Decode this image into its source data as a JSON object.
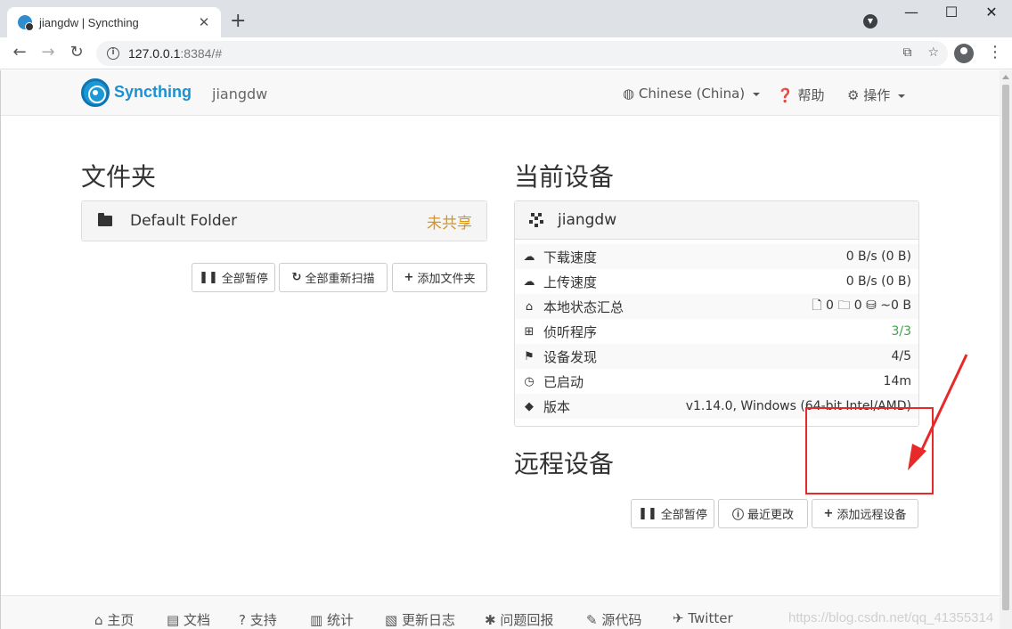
{
  "browser": {
    "tab_title": "jiangdw | Syncthing",
    "url_host": "127.0.0.1",
    "url_rest": ":8384/#",
    "new_tab": "+",
    "close_tab": "✕"
  },
  "navbar": {
    "brand": "Syncthing",
    "hostname": "jiangdw",
    "language": "Chinese (China)",
    "help": "帮助",
    "actions": "操作"
  },
  "folders": {
    "heading": "文件夹",
    "items": [
      {
        "name": "Default Folder",
        "status": "未共享"
      }
    ],
    "buttons": {
      "pause_all": "全部暂停",
      "rescan_all": "全部重新扫描",
      "add_folder": "添加文件夹"
    }
  },
  "this_device": {
    "heading": "当前设备",
    "name": "jiangdw",
    "stats": [
      {
        "icon": "cloud-download-icon",
        "glyph": "☁",
        "label": "下载速度",
        "value": "0 B/s (0 B)"
      },
      {
        "icon": "cloud-upload-icon",
        "glyph": "☁",
        "label": "上传速度",
        "value": "0 B/s (0 B)"
      },
      {
        "icon": "home-icon",
        "glyph": "⌂",
        "label": "本地状态汇总",
        "value": "🗋 0  🗀 0  ⛁ ~0 B"
      },
      {
        "icon": "sitemap-icon",
        "glyph": "⊞",
        "label": "侦听程序",
        "value": "3/3"
      },
      {
        "icon": "signpost-icon",
        "glyph": "⚑",
        "label": "设备发现",
        "value": "4/5"
      },
      {
        "icon": "clock-icon",
        "glyph": "◷",
        "label": "已启动",
        "value": "14m"
      },
      {
        "icon": "tag-icon",
        "glyph": "◆",
        "label": "版本",
        "value": "v1.14.0, Windows (64-bit Intel/AMD)"
      }
    ]
  },
  "remote_devices": {
    "heading": "远程设备",
    "buttons": {
      "pause_all": "全部暂停",
      "recent_changes": "最近更改",
      "add_device": "添加远程设备"
    }
  },
  "footer": {
    "home": "主页",
    "docs": "文档",
    "support": "支持",
    "stats": "统计",
    "changelog": "更新日志",
    "bugs": "问题回报",
    "source": "源代码",
    "twitter": "Twitter",
    "watermark": "https://blog.csdn.net/qq_41355314"
  },
  "colors": {
    "brand": "#1b91d1",
    "unshared": "#d9941a",
    "listeners_ok": "#3fa34d",
    "annotation": "#e82929"
  }
}
